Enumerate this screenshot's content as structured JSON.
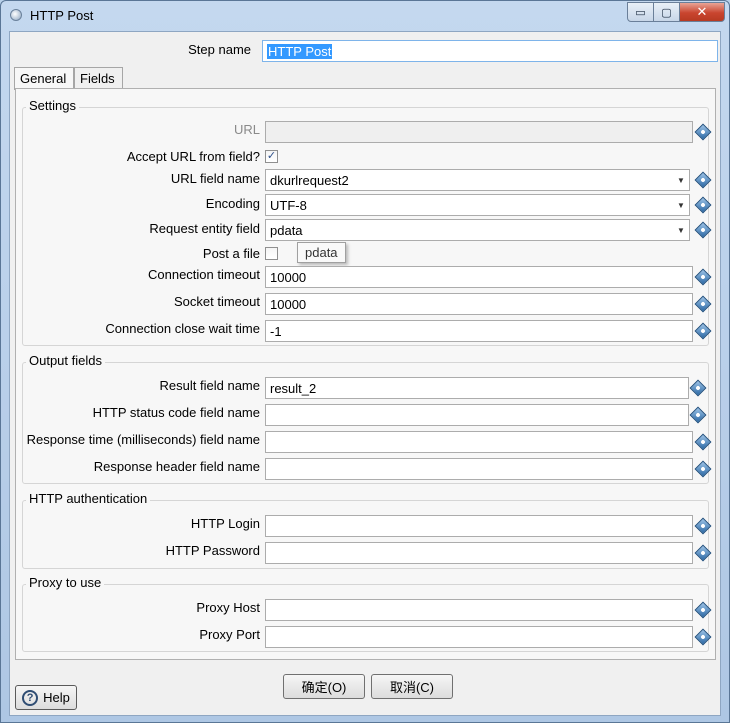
{
  "window": {
    "title": "HTTP Post",
    "icon": "pentaho-step-icon"
  },
  "titlebar_controls": {
    "minimize": "▭",
    "maximize": "▢",
    "close": "✕"
  },
  "step": {
    "label": "Step name",
    "value": "HTTP Post"
  },
  "tabs": [
    {
      "label": "General"
    },
    {
      "label": "Fields"
    }
  ],
  "settings": {
    "title": "Settings",
    "url": {
      "label": "URL",
      "value": ""
    },
    "accept_url": {
      "label": "Accept URL from field?",
      "checked": true
    },
    "url_field": {
      "label": "URL field name",
      "value": "dkurlrequest2"
    },
    "encoding": {
      "label": "Encoding",
      "value": "UTF-8"
    },
    "request_entity": {
      "label": "Request entity field",
      "value": "pdata"
    },
    "post_file": {
      "label": "Post a file",
      "checked": false
    },
    "connection_timeout": {
      "label": "Connection timeout",
      "value": "10000"
    },
    "socket_timeout": {
      "label": "Socket timeout",
      "value": "10000"
    },
    "close_wait": {
      "label": "Connection close wait time",
      "value": "-1"
    }
  },
  "tooltip": {
    "text": "pdata"
  },
  "output": {
    "title": "Output fields",
    "result": {
      "label": "Result field name",
      "value": "result_2"
    },
    "status_code": {
      "label": "HTTP status code field name",
      "value": ""
    },
    "response_time": {
      "label": "Response time (milliseconds) field name",
      "value": ""
    },
    "response_header": {
      "label": "Response header field name",
      "value": ""
    }
  },
  "auth": {
    "title": "HTTP authentication",
    "login": {
      "label": "HTTP Login",
      "value": ""
    },
    "password": {
      "label": "HTTP Password",
      "value": ""
    }
  },
  "proxy": {
    "title": "Proxy to use",
    "host": {
      "label": "Proxy Host",
      "value": ""
    },
    "port": {
      "label": "Proxy Port",
      "value": ""
    }
  },
  "buttons": {
    "help": "Help",
    "ok": "确定(O)",
    "cancel": "取消(C)"
  },
  "icons": {
    "variable": "variable-diamond-icon",
    "combo": "▼",
    "check": "✓",
    "help": "?"
  }
}
